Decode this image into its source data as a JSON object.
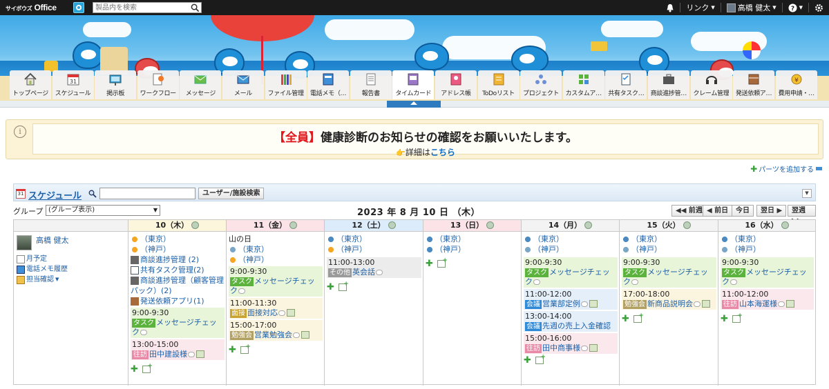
{
  "topbar": {
    "logo_small": "サイボウズ",
    "logo": "Office",
    "search_placeholder": "製品内を検索",
    "link_label": "リンク",
    "user_name": "高橋 健太"
  },
  "nav": [
    {
      "label": "トップページ",
      "icon": "home-icon"
    },
    {
      "label": "スケジュール",
      "icon": "calendar-icon"
    },
    {
      "label": "掲示板",
      "icon": "board-icon"
    },
    {
      "label": "ワークフロー",
      "icon": "workflow-icon"
    },
    {
      "label": "メッセージ",
      "icon": "message-icon"
    },
    {
      "label": "メール",
      "icon": "mail-icon"
    },
    {
      "label": "ファイル管理",
      "icon": "file-icon"
    },
    {
      "label": "電話メモ（…",
      "icon": "phone-memo-icon"
    },
    {
      "label": "報告書",
      "icon": "report-icon"
    },
    {
      "label": "タイムカード",
      "icon": "timecard-icon"
    },
    {
      "label": "アドレス帳",
      "icon": "address-book-icon"
    },
    {
      "label": "ToDoリスト",
      "icon": "todo-icon"
    },
    {
      "label": "プロジェクト",
      "icon": "project-icon"
    },
    {
      "label": "カスタムア…",
      "icon": "custom-app-icon"
    },
    {
      "label": "共有タスク…",
      "icon": "shared-task-icon"
    },
    {
      "label": "商談進捗管…",
      "icon": "deal-icon"
    },
    {
      "label": "クレーム管理",
      "icon": "headset-icon"
    },
    {
      "label": "発送依頼ア…",
      "icon": "shipping-icon"
    },
    {
      "label": "費用申請・…",
      "icon": "expense-icon"
    }
  ],
  "notice": {
    "tag": "【全員】",
    "title": "健康診断のお知らせの確認をお願いいたします。",
    "sub_prefix": "詳細は",
    "sub_link": "こちら"
  },
  "add_parts": "パーツを追加する",
  "schedule": {
    "title": "スケジュール",
    "user_search": "ユーザー/施設検索",
    "group_label": "グループ",
    "group_selected": "(グループ表示)",
    "date_title": "2023 年 8 月 10 日 （木）",
    "btn_prev_week": "◀◀ 前週",
    "btn_prev_day": "◀ 前日",
    "btn_today": "今日",
    "btn_next_day": "翌日 ▶",
    "btn_next_week": "翌週 ▶▶",
    "user": {
      "name": "高橋 健太",
      "links": [
        "月予定",
        "電話メモ履歴",
        "担当確認"
      ]
    },
    "days": [
      {
        "label": "10（木）",
        "color": "#fbf6dc"
      },
      {
        "label": "11（金）",
        "color": "#fbe3e8"
      },
      {
        "label": "12（土）",
        "color": "#dcecfa"
      },
      {
        "label": "13（日）",
        "color": "#fbe3e8"
      },
      {
        "label": "14（月）",
        "color": "#f3f3f3"
      },
      {
        "label": "15（火）",
        "color": "#f3f3f3"
      },
      {
        "label": "16（水）",
        "color": "#f3f3f3"
      }
    ],
    "d10": {
      "w1": "（東京）",
      "w2": "（神戸）",
      "apps": [
        "商談進捗管理 (2)",
        "共有タスク管理(2)",
        "商談進捗管理（顧客管理",
        "パック）(2)",
        "発送依頼アプリ(1)"
      ],
      "ev1_time": "9:00-9:30",
      "ev1_tag": "タスク",
      "ev1_title": "メッセージチェッ",
      "ev1_title2": "ク",
      "ev2_time": "13:00-15:00",
      "ev2_tag": "往訪",
      "ev2_title": "田中建設様"
    },
    "d11": {
      "holiday": "山の日",
      "w1": "（東京）",
      "w2": "（神戸）",
      "ev1_time": "9:00-9:30",
      "ev1_tag": "タスク",
      "ev1_title": "メッセージチェッ",
      "ev1_title2": "ク",
      "ev2_time": "11:00-11:30",
      "ev2_tag": "面接",
      "ev2_title": "面接対応",
      "ev3_time": "15:00-17:00",
      "ev3_tag": "勉強会",
      "ev3_title": "営業勉強会"
    },
    "d12": {
      "w1": "（東京）",
      "w2": "（神戸）",
      "ev1_time": "11:00-13:00",
      "ev1_tag": "その他",
      "ev1_title": "英会話"
    },
    "d13": {
      "w1": "（東京）",
      "w2": "（神戸）"
    },
    "d14": {
      "w1": "（東京）",
      "w2": "（神戸）",
      "ev1_time": "9:00-9:30",
      "ev1_tag": "タスク",
      "ev1_title": "メッセージチェッ",
      "ev1_title2": "ク",
      "ev2_time": "11:00-12:00",
      "ev2_tag": "会議",
      "ev2_title": "営業部定例",
      "ev3_time": "13:00-14:00",
      "ev3_tag": "会議",
      "ev3_title": "先週の売上入金確認",
      "ev4_time": "15:00-16:00",
      "ev4_tag": "往訪",
      "ev4_title": "田中商事様"
    },
    "d15": {
      "w1": "（東京）",
      "w2": "（神戸）",
      "ev1_time": "9:00-9:30",
      "ev1_tag": "タスク",
      "ev1_title": "メッセージチェッ",
      "ev1_title2": "ク",
      "ev2_time": "17:00-18:00",
      "ev2_tag": "勉強会",
      "ev2_title": "新商品説明会"
    },
    "d16": {
      "w1": "（東京）",
      "w2": "（神戸）",
      "ev1_time": "9:00-9:30",
      "ev1_tag": "タスク",
      "ev1_title": "メッセージチェッ",
      "ev1_title2": "ク",
      "ev2_time": "11:00-12:00",
      "ev2_tag": "往訪",
      "ev2_title": "山本海運様"
    }
  },
  "colors": {
    "tag_task": "#5bb33d",
    "tag_visit": "#e989a8",
    "tag_meeting": "#2e8ad6",
    "tag_study": "#b2a063",
    "tag_interview": "#c9a32f",
    "tag_other": "#9a9a9a"
  }
}
